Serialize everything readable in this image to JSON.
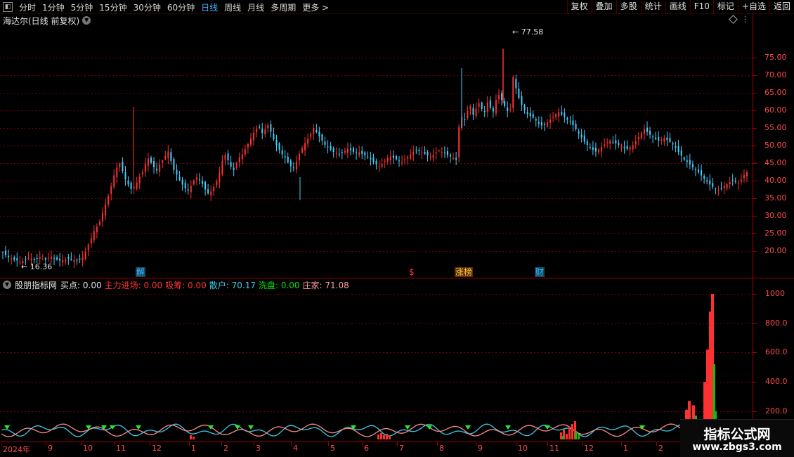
{
  "toolbar": {
    "menu_icon": "collapse-icon",
    "periods": [
      "分时",
      "1分钟",
      "5分钟",
      "15分钟",
      "30分钟",
      "60分钟",
      "日线",
      "周线",
      "月线",
      "多周期",
      "更多 >"
    ],
    "active_period": "日线",
    "actions": [
      "复权",
      "叠加",
      "多股",
      "统计",
      "画线",
      "F10",
      "标记",
      "+自选",
      "返回"
    ]
  },
  "price_panel": {
    "title": "海达尔(日线 前复权)",
    "y_ticks": [
      "75.00",
      "70.00",
      "65.00",
      "60.00",
      "55.00",
      "50.00",
      "45.00",
      "40.00",
      "35.00",
      "30.00",
      "25.00",
      "20.00"
    ],
    "high_label": "77.58",
    "low_label": "16.36",
    "event_labels": [
      {
        "text": "解",
        "color": "#3fb5ff"
      },
      {
        "text": "$",
        "color": "#ff3030"
      },
      {
        "text": "涨榜",
        "color": "#ffcc33"
      },
      {
        "text": "财",
        "color": "#3fb5ff"
      }
    ]
  },
  "indicator_panel": {
    "name": "股朋指标网",
    "fields": [
      {
        "label": "买点:",
        "value": "0.00",
        "color": "#e0e0e0"
      },
      {
        "label": "主力进场:",
        "value": "0.00",
        "color": "#ff3030"
      },
      {
        "label": "吸筹:",
        "value": "0.00",
        "color": "#ff3030"
      },
      {
        "label": "散户:",
        "value": "70.17",
        "color": "#44c8e8"
      },
      {
        "label": "洗盘:",
        "value": "0.00",
        "color": "#00dd00"
      },
      {
        "label": "庄家:",
        "value": "71.08",
        "color": "#ff9a9a"
      }
    ],
    "y_ticks": [
      "1000",
      "800.0",
      "600.0",
      "400.0",
      "200.0"
    ]
  },
  "date_axis": [
    "2024年",
    "9",
    "10",
    "11",
    "12",
    "1",
    "2",
    "3",
    "4",
    "5",
    "6",
    "7",
    "8",
    "9",
    "10",
    "11",
    "12",
    "1",
    "2"
  ],
  "watermark": {
    "title": "指标公式网",
    "url": "www.zbgs3.com"
  },
  "colors": {
    "up": "#ff3030",
    "down": "#40d0ff",
    "grid": "#7a0000",
    "axis_text": "#ff4b4b"
  },
  "chart_data": {
    "type": "candlestick",
    "price_range": [
      16.36,
      77.58
    ],
    "close_series": [
      19.5,
      18.8,
      18.2,
      17.9,
      17.5,
      17.3,
      16.9,
      17.2,
      17.6,
      18.0,
      17.8,
      17.4,
      17.9,
      18.3,
      17.8,
      17.5,
      18.1,
      18.4,
      17.7,
      17.5,
      17.3,
      17.4,
      17.6,
      17.8,
      17.5,
      17.4,
      17.3,
      17.6,
      18.2,
      19.8,
      21.8,
      23.6,
      25.6,
      26.9,
      28.3,
      30.8,
      33.2,
      35.6,
      38.4,
      41.5,
      43.7,
      44.9,
      42.8,
      40.4,
      38.9,
      37.6,
      38.3,
      39.4,
      41.2,
      42.5,
      44.8,
      46.3,
      45.1,
      43.8,
      42.9,
      44.7,
      45.8,
      47.0,
      48.3,
      45.6,
      43.1,
      41.7,
      40.1,
      38.9,
      37.8,
      37.2,
      38.5,
      40.0,
      40.9,
      40.2,
      39.1,
      37.5,
      36.4,
      36.9,
      38.2,
      39.8,
      42.3,
      45.6,
      47.3,
      45.8,
      44.0,
      43.1,
      45.1,
      46.7,
      47.5,
      48.9,
      50.4,
      52.1,
      53.6,
      54.8,
      55.2,
      53.6,
      54.5,
      55.8,
      53.9,
      51.7,
      50.1,
      48.7,
      47.5,
      46.6,
      45.2,
      44.1,
      43.7,
      45.4,
      47.6,
      49.2,
      50.7,
      51.9,
      53.3,
      55.0,
      53.8,
      52.6,
      51.4,
      50.2,
      49.5,
      48.8,
      48.2,
      47.9,
      47.6,
      47.9,
      48.5,
      49.1,
      48.7,
      48.2,
      47.8,
      48.1,
      47.6,
      47.3,
      46.8,
      46.1,
      45.4,
      44.6,
      44.1,
      44.8,
      45.6,
      46.4,
      46.9,
      46.5,
      46.1,
      45.7,
      45.4,
      46.0,
      46.8,
      47.5,
      48.2,
      48.7,
      48.4,
      48.0,
      47.6,
      47.2,
      46.9,
      47.4,
      48.1,
      48.6,
      48.2,
      47.8,
      47.3,
      46.9,
      46.4,
      46.0,
      55.3,
      58.1,
      57.4,
      59.8,
      61.2,
      58.7,
      60.5,
      62.1,
      60.4,
      59.6,
      62.3,
      60.8,
      59.7,
      62.9,
      64.4,
      63.0,
      61.2,
      59.8,
      60.4,
      69.5,
      66.3,
      63.5,
      61.6,
      60.1,
      59.0,
      58.4,
      57.9,
      57.1,
      56.2,
      55.7,
      55.9,
      56.6,
      57.3,
      58.1,
      58.9,
      59.5,
      58.8,
      58.1,
      57.4,
      56.7,
      55.8,
      54.6,
      53.4,
      52.3,
      51.1,
      50.2,
      49.5,
      48.8,
      48.3,
      48.9,
      49.6,
      50.3,
      50.9,
      51.4,
      51.0,
      50.6,
      50.2,
      49.7,
      49.3,
      49.0,
      49.5,
      50.1,
      51.2,
      52.4,
      53.7,
      54.6,
      53.9,
      53.1,
      52.4,
      51.8,
      51.4,
      51.7,
      52.1,
      51.6,
      51.0,
      50.3,
      49.4,
      48.2,
      47.1,
      46.0,
      45.3,
      44.6,
      43.8,
      43.1,
      42.4,
      41.5,
      40.6,
      39.7,
      38.9,
      38.2,
      37.6,
      37.3,
      37.8,
      38.4,
      39.0,
      39.6,
      40.1,
      39.7,
      39.4,
      40.3,
      41.6,
      42.4
    ]
  }
}
